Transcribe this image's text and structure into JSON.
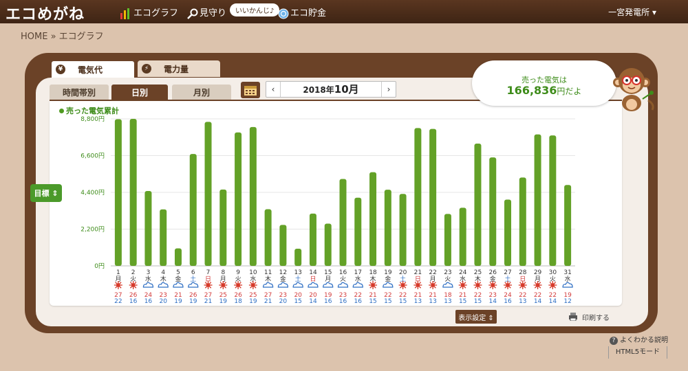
{
  "header": {
    "logo": "エコめがね",
    "nav": [
      "エコグラフ",
      "見守り",
      "エコ貯金"
    ],
    "bubble": "いいかんじ♪",
    "plant": "一宮発電所 ▾"
  },
  "breadcrumb": "HOME » エコグラフ",
  "tabs": {
    "primary": [
      "電気代",
      "電力量"
    ],
    "primary_icons": [
      "¥",
      "⚡"
    ],
    "secondary": [
      "時間帯別",
      "日別",
      "月別"
    ]
  },
  "date": {
    "prev": "‹",
    "next": "›",
    "year_text": "2018年",
    "month_text": "10月"
  },
  "sold": {
    "label": "売った電気は",
    "value": "166,836",
    "suffix": "円だよ"
  },
  "goal_button": "目標 ⇕",
  "buttons": {
    "display": "表示設定 ⇕",
    "print": "印刷する"
  },
  "footer": {
    "help": "よくわかる説明",
    "help_icon": "?",
    "html5": "HTML5モード"
  },
  "colors": {
    "bar": "#63a127",
    "weekday_text": "#333333",
    "saturday": "#2f6fc4",
    "sunday": "#d23b3b",
    "sun": "#d63a2a",
    "cloud": "#2f6fc4",
    "high": "#d23b3b",
    "low": "#2f6fc4"
  },
  "chart_data": {
    "type": "bar",
    "title": "",
    "legend": "売った電気累計",
    "yticks": [
      "0円",
      "2,200円",
      "4,400円",
      "6,600円",
      "8,800円"
    ],
    "ylim": [
      0,
      8800
    ],
    "grid": true,
    "categories": [
      "1",
      "2",
      "3",
      "4",
      "5",
      "6",
      "7",
      "8",
      "9",
      "10",
      "11",
      "12",
      "13",
      "14",
      "15",
      "16",
      "17",
      "18",
      "19",
      "20",
      "21",
      "22",
      "23",
      "24",
      "25",
      "26",
      "27",
      "28",
      "29",
      "30",
      "31"
    ],
    "weekdays": [
      "月",
      "火",
      "水",
      "木",
      "金",
      "土",
      "日",
      "月",
      "火",
      "水",
      "木",
      "金",
      "土",
      "日",
      "月",
      "火",
      "水",
      "木",
      "金",
      "土",
      "日",
      "月",
      "火",
      "水",
      "木",
      "金",
      "土",
      "日",
      "月",
      "火",
      "水"
    ],
    "values": [
      8780,
      8800,
      4480,
      3380,
      1050,
      6700,
      8620,
      4570,
      7990,
      8310,
      3390,
      2450,
      1030,
      3130,
      2530,
      5200,
      4080,
      5610,
      4560,
      4310,
      8250,
      8200,
      3110,
      3480,
      7320,
      6490,
      3970,
      5290,
      7870,
      7810,
      4840
    ],
    "weather": [
      "sun",
      "sun",
      "cloud",
      "cloud",
      "cloud",
      "cloud",
      "sun",
      "sun",
      "sun",
      "sun",
      "cloud",
      "cloud",
      "cloud",
      "cloud",
      "cloud",
      "cloud",
      "cloud",
      "sun",
      "cloud",
      "sun",
      "sun",
      "sun",
      "cloud",
      "sun",
      "sun",
      "sun",
      "sun",
      "sun",
      "sun",
      "sun",
      "cloud"
    ],
    "high_temps": [
      "27",
      "26",
      "24",
      "23",
      "21",
      "26",
      "27",
      "25",
      "26",
      "25",
      "27",
      "23",
      "20",
      "20",
      "19",
      "23",
      "22",
      "21",
      "22",
      "22",
      "21",
      "21",
      "18",
      "21",
      "22",
      "23",
      "24",
      "22",
      "22",
      "22",
      "19"
    ],
    "low_temps": [
      "22",
      "16",
      "16",
      "20",
      "19",
      "19",
      "21",
      "19",
      "18",
      "19",
      "21",
      "20",
      "15",
      "14",
      "16",
      "16",
      "16",
      "15",
      "15",
      "15",
      "13",
      "13",
      "13",
      "15",
      "15",
      "14",
      "16",
      "13",
      "14",
      "14",
      "12"
    ]
  }
}
